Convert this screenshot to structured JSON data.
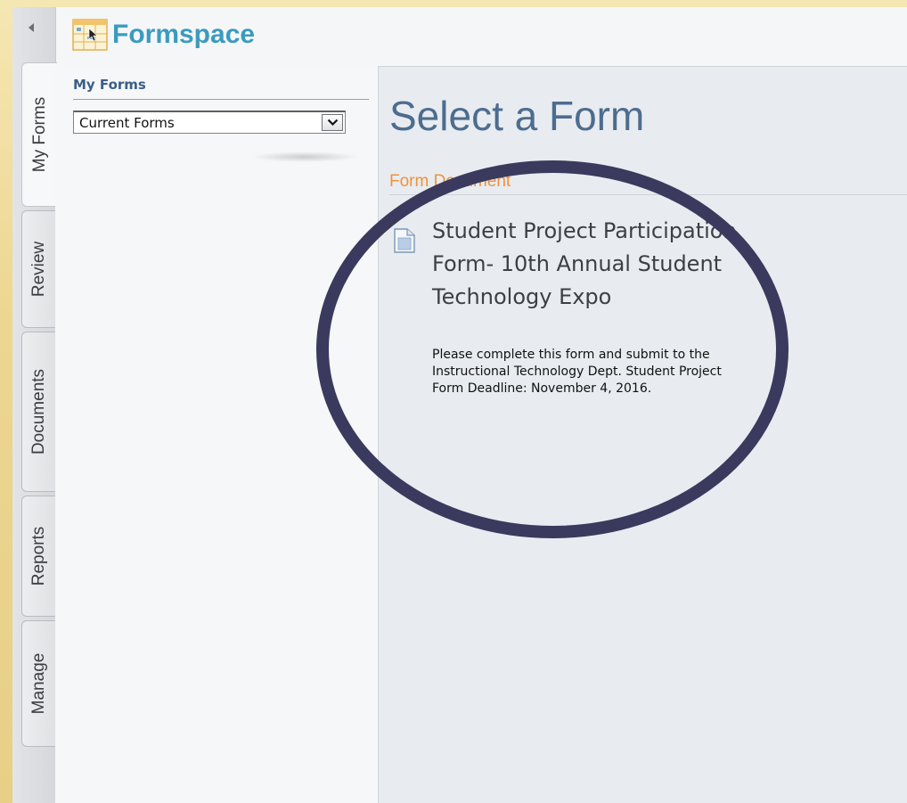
{
  "app": {
    "logo_text": "Formspace",
    "logo_icon": "formspace-logo-icon",
    "collapse_icon": "chevron-left-icon"
  },
  "tabs": [
    {
      "label": "My Forms",
      "active": true
    },
    {
      "label": "Review",
      "active": false
    },
    {
      "label": "Documents",
      "active": false
    },
    {
      "label": "Reports",
      "active": false
    },
    {
      "label": "Manage",
      "active": false
    }
  ],
  "left_panel": {
    "heading": "My Forms",
    "select": {
      "value": "Current Forms",
      "icon": "chevron-down-icon"
    }
  },
  "main": {
    "title": "Select a Form",
    "section_label": "Form Document",
    "form": {
      "title": "Student Project Participation Form- 10th Annual Student Technology Expo",
      "description": "Please complete this form and submit to the Instructional Technology Dept. Student Project Form Deadline: November 4, 2016.",
      "icon": "document-icon"
    }
  },
  "colors": {
    "logo": "#3a9bbf",
    "title": "#4d6d8f",
    "section_label": "#f0923a",
    "annotation_ring": "#3a3a5e",
    "frame": "#f4e3a4"
  }
}
